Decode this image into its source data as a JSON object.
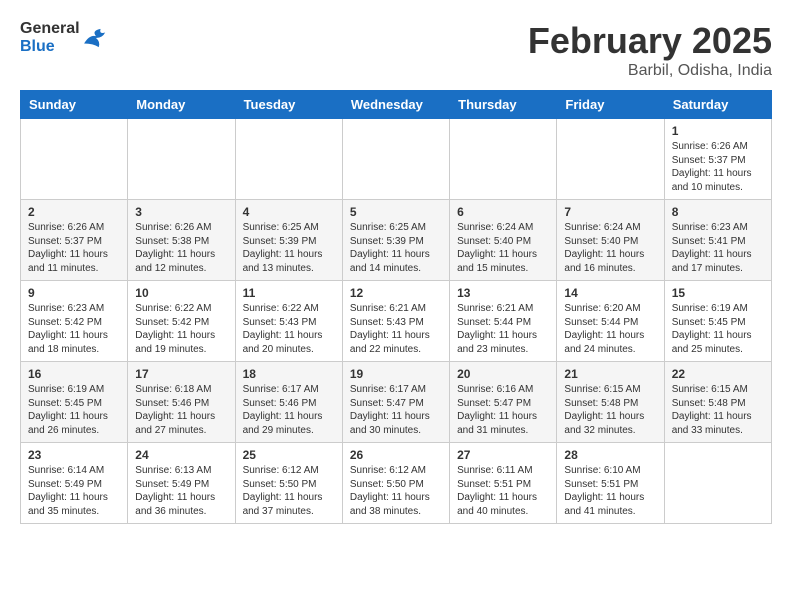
{
  "header": {
    "logo_general": "General",
    "logo_blue": "Blue",
    "month_title": "February 2025",
    "location": "Barbil, Odisha, India"
  },
  "days_of_week": [
    "Sunday",
    "Monday",
    "Tuesday",
    "Wednesday",
    "Thursday",
    "Friday",
    "Saturday"
  ],
  "weeks": [
    [
      {
        "day": "",
        "info": ""
      },
      {
        "day": "",
        "info": ""
      },
      {
        "day": "",
        "info": ""
      },
      {
        "day": "",
        "info": ""
      },
      {
        "day": "",
        "info": ""
      },
      {
        "day": "",
        "info": ""
      },
      {
        "day": "1",
        "info": "Sunrise: 6:26 AM\nSunset: 5:37 PM\nDaylight: 11 hours and 10 minutes."
      }
    ],
    [
      {
        "day": "2",
        "info": "Sunrise: 6:26 AM\nSunset: 5:37 PM\nDaylight: 11 hours and 11 minutes."
      },
      {
        "day": "3",
        "info": "Sunrise: 6:26 AM\nSunset: 5:38 PM\nDaylight: 11 hours and 12 minutes."
      },
      {
        "day": "4",
        "info": "Sunrise: 6:25 AM\nSunset: 5:39 PM\nDaylight: 11 hours and 13 minutes."
      },
      {
        "day": "5",
        "info": "Sunrise: 6:25 AM\nSunset: 5:39 PM\nDaylight: 11 hours and 14 minutes."
      },
      {
        "day": "6",
        "info": "Sunrise: 6:24 AM\nSunset: 5:40 PM\nDaylight: 11 hours and 15 minutes."
      },
      {
        "day": "7",
        "info": "Sunrise: 6:24 AM\nSunset: 5:40 PM\nDaylight: 11 hours and 16 minutes."
      },
      {
        "day": "8",
        "info": "Sunrise: 6:23 AM\nSunset: 5:41 PM\nDaylight: 11 hours and 17 minutes."
      }
    ],
    [
      {
        "day": "9",
        "info": "Sunrise: 6:23 AM\nSunset: 5:42 PM\nDaylight: 11 hours and 18 minutes."
      },
      {
        "day": "10",
        "info": "Sunrise: 6:22 AM\nSunset: 5:42 PM\nDaylight: 11 hours and 19 minutes."
      },
      {
        "day": "11",
        "info": "Sunrise: 6:22 AM\nSunset: 5:43 PM\nDaylight: 11 hours and 20 minutes."
      },
      {
        "day": "12",
        "info": "Sunrise: 6:21 AM\nSunset: 5:43 PM\nDaylight: 11 hours and 22 minutes."
      },
      {
        "day": "13",
        "info": "Sunrise: 6:21 AM\nSunset: 5:44 PM\nDaylight: 11 hours and 23 minutes."
      },
      {
        "day": "14",
        "info": "Sunrise: 6:20 AM\nSunset: 5:44 PM\nDaylight: 11 hours and 24 minutes."
      },
      {
        "day": "15",
        "info": "Sunrise: 6:19 AM\nSunset: 5:45 PM\nDaylight: 11 hours and 25 minutes."
      }
    ],
    [
      {
        "day": "16",
        "info": "Sunrise: 6:19 AM\nSunset: 5:45 PM\nDaylight: 11 hours and 26 minutes."
      },
      {
        "day": "17",
        "info": "Sunrise: 6:18 AM\nSunset: 5:46 PM\nDaylight: 11 hours and 27 minutes."
      },
      {
        "day": "18",
        "info": "Sunrise: 6:17 AM\nSunset: 5:46 PM\nDaylight: 11 hours and 29 minutes."
      },
      {
        "day": "19",
        "info": "Sunrise: 6:17 AM\nSunset: 5:47 PM\nDaylight: 11 hours and 30 minutes."
      },
      {
        "day": "20",
        "info": "Sunrise: 6:16 AM\nSunset: 5:47 PM\nDaylight: 11 hours and 31 minutes."
      },
      {
        "day": "21",
        "info": "Sunrise: 6:15 AM\nSunset: 5:48 PM\nDaylight: 11 hours and 32 minutes."
      },
      {
        "day": "22",
        "info": "Sunrise: 6:15 AM\nSunset: 5:48 PM\nDaylight: 11 hours and 33 minutes."
      }
    ],
    [
      {
        "day": "23",
        "info": "Sunrise: 6:14 AM\nSunset: 5:49 PM\nDaylight: 11 hours and 35 minutes."
      },
      {
        "day": "24",
        "info": "Sunrise: 6:13 AM\nSunset: 5:49 PM\nDaylight: 11 hours and 36 minutes."
      },
      {
        "day": "25",
        "info": "Sunrise: 6:12 AM\nSunset: 5:50 PM\nDaylight: 11 hours and 37 minutes."
      },
      {
        "day": "26",
        "info": "Sunrise: 6:12 AM\nSunset: 5:50 PM\nDaylight: 11 hours and 38 minutes."
      },
      {
        "day": "27",
        "info": "Sunrise: 6:11 AM\nSunset: 5:51 PM\nDaylight: 11 hours and 40 minutes."
      },
      {
        "day": "28",
        "info": "Sunrise: 6:10 AM\nSunset: 5:51 PM\nDaylight: 11 hours and 41 minutes."
      },
      {
        "day": "",
        "info": ""
      }
    ]
  ]
}
